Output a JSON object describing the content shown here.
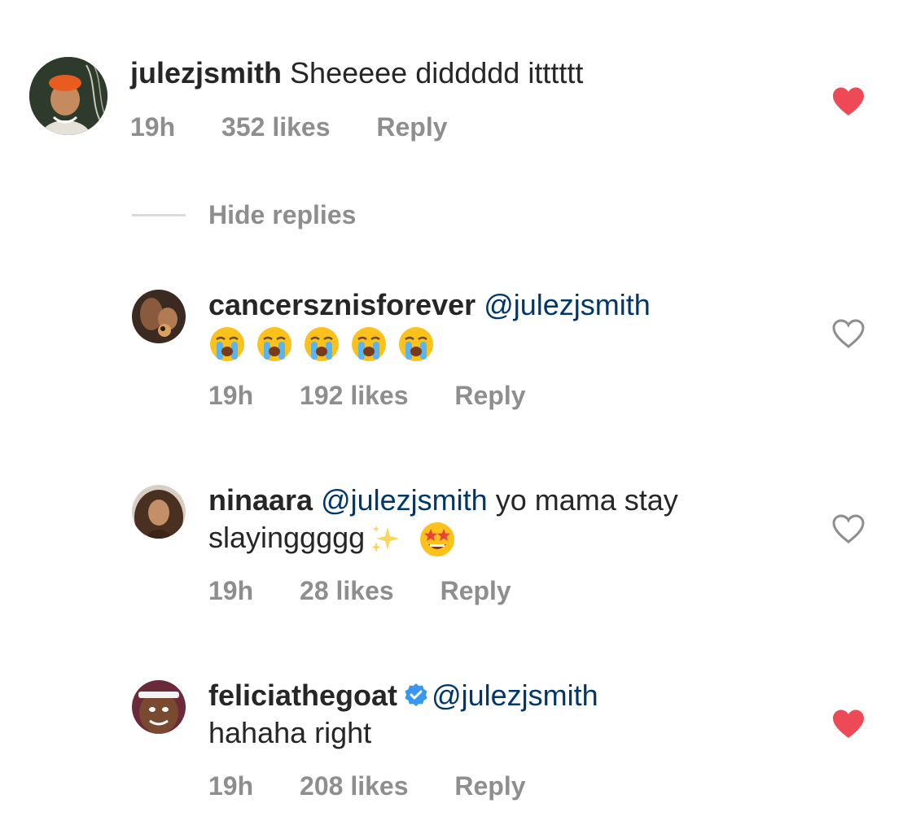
{
  "comment": {
    "username": "julezjsmith",
    "text": "Sheeeee diddddd itttttt",
    "time": "19h",
    "likes": "352 likes",
    "reply": "Reply",
    "liked": true
  },
  "hide_replies": "Hide replies",
  "replies": [
    {
      "username": "cancersznisforever",
      "mention": "@julezjsmith",
      "text": "",
      "emoji": [
        "loudly-crying-face-emoji",
        "loudly-crying-face-emoji",
        "loudly-crying-face-emoji",
        "loudly-crying-face-emoji",
        "loudly-crying-face-emoji"
      ],
      "time": "19h",
      "likes": "192 likes",
      "reply": "Reply",
      "liked": false
    },
    {
      "username": "ninaara",
      "mention": "@julezjsmith",
      "text_line1": "yo mama stay",
      "text_line2": "slayinggggg",
      "emoji": [
        "sparkles-emoji",
        "star-struck-emoji"
      ],
      "time": "19h",
      "likes": "28 likes",
      "reply": "Reply",
      "liked": false
    },
    {
      "username": "feliciathegoat",
      "verified": true,
      "mention": "@julezjsmith",
      "text": "hahaha right",
      "time": "19h",
      "likes": "208 likes",
      "reply": "Reply",
      "liked": true
    }
  ],
  "colors": {
    "heart_liked": "#ed4956",
    "heart_outline": "#8e8e8e",
    "mention": "#00376b",
    "meta": "#8e8e8e",
    "verified": "#3897f0"
  },
  "icons": {
    "liked": "heart-filled-icon",
    "not_liked": "heart-outline-icon",
    "verified": "verified-badge-icon"
  }
}
